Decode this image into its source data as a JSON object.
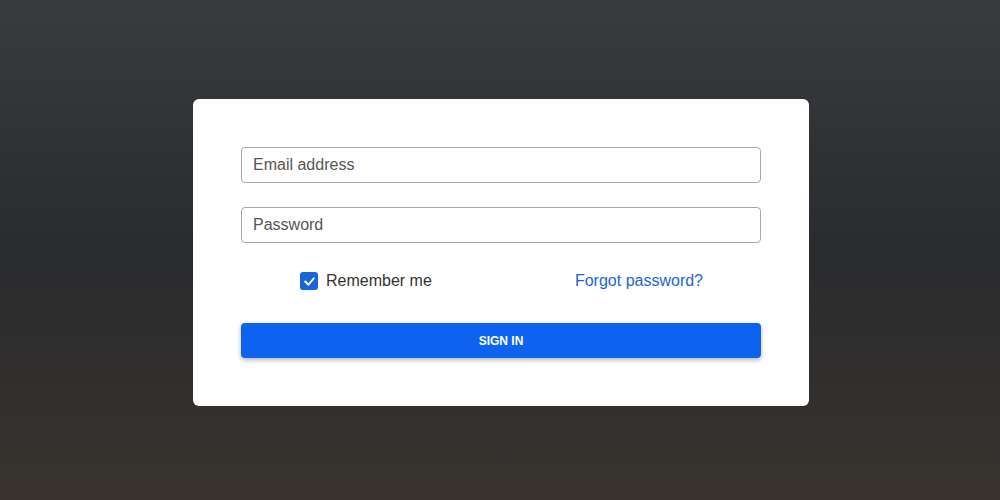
{
  "login_form": {
    "email": {
      "placeholder": "Email address"
    },
    "password": {
      "placeholder": "Password"
    },
    "remember_me": {
      "label": "Remember me",
      "checked": true
    },
    "forgot_password": {
      "label": "Forgot password?"
    },
    "submit_button": {
      "label": "SIGN IN"
    }
  }
}
